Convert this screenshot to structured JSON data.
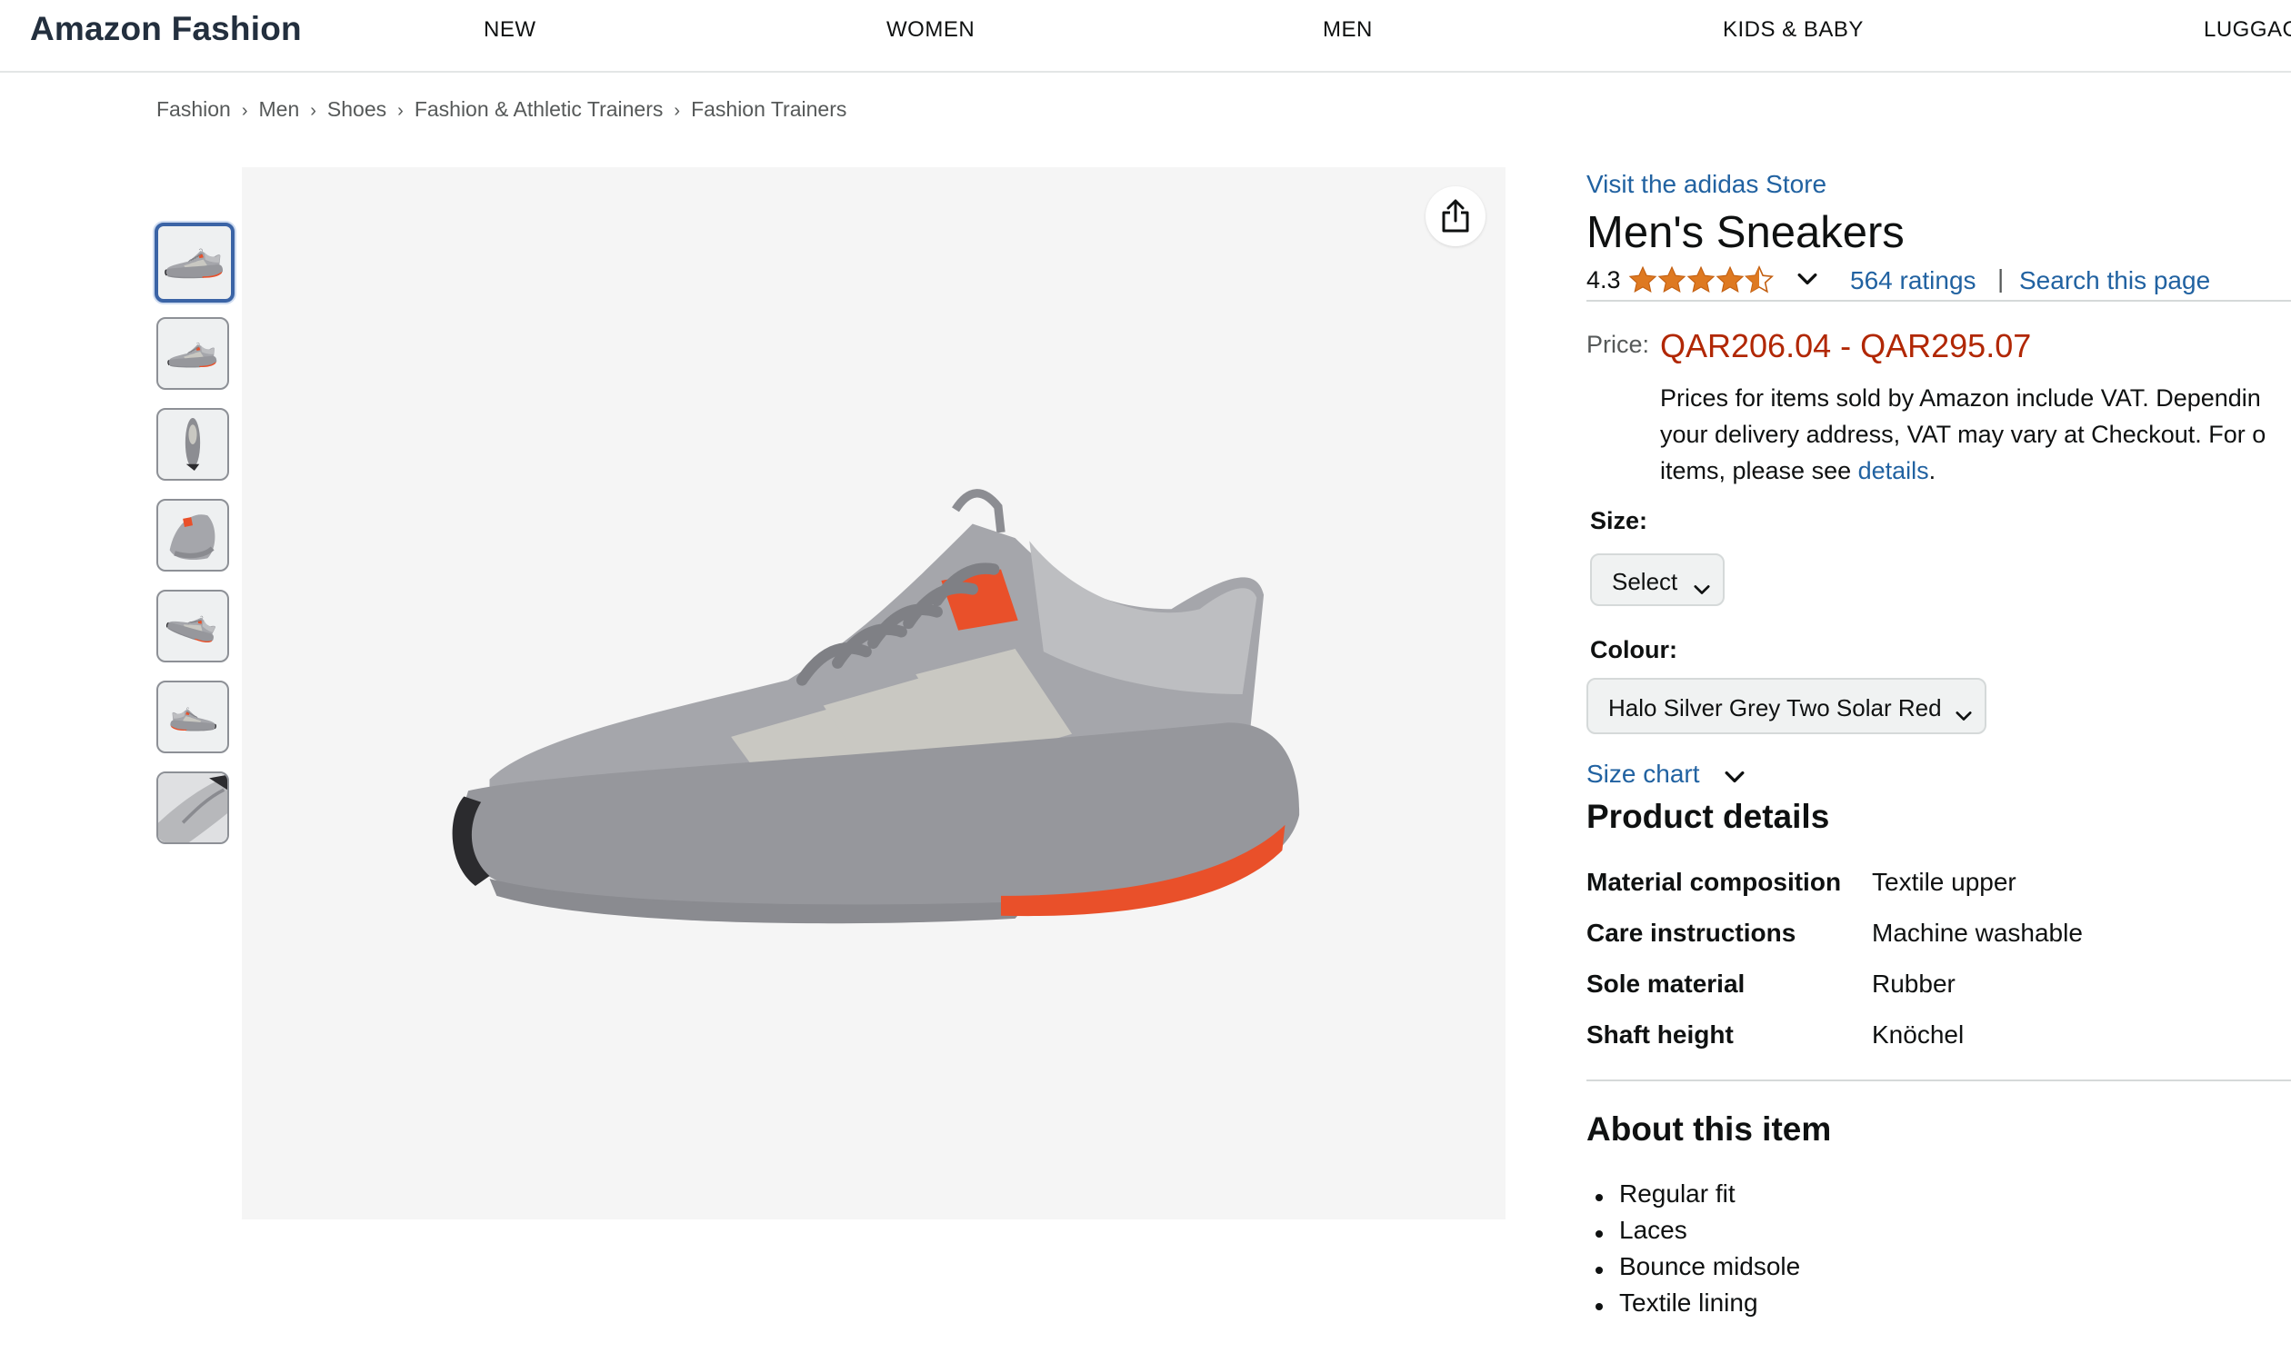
{
  "header": {
    "brand": "Amazon Fashion",
    "nav": [
      "NEW",
      "WOMEN",
      "MEN",
      "KIDS & BABY",
      "LUGGAG"
    ]
  },
  "breadcrumb": [
    "Fashion",
    "Men",
    "Shoes",
    "Fashion & Athletic Trainers",
    "Fashion Trainers"
  ],
  "breadcrumb_separator": "›",
  "gallery": {
    "thumbnail_count": 7,
    "selected_index": 0
  },
  "product": {
    "store_link": "Visit the adidas Store",
    "title": "Men's Sneakers",
    "rating": "4.3",
    "rating_stars": 4.5,
    "ratings_count": "564 ratings",
    "separator": "|",
    "search_link": "Search this page",
    "price_label": "Price:",
    "price_range": "QAR206.04 - QAR295.07",
    "vat_line1": "Prices for items sold by Amazon include VAT. Dependin",
    "vat_line2": "your delivery address, VAT may vary at Checkout. For o",
    "vat_line3_prefix": "items, please see ",
    "vat_link": "details",
    "vat_line3_suffix": "."
  },
  "size": {
    "label": "Size:",
    "selected": "Select"
  },
  "colour": {
    "label": "Colour:",
    "selected": "Halo Silver Grey Two Solar Red"
  },
  "size_chart": "Size chart",
  "product_details": {
    "title": "Product details",
    "rows": [
      {
        "key": "Material composition",
        "value": "Textile upper"
      },
      {
        "key": "Care instructions",
        "value": "Machine washable"
      },
      {
        "key": "Sole material",
        "value": "Rubber"
      },
      {
        "key": "Shaft height",
        "value": "Knöchel"
      }
    ]
  },
  "about": {
    "title": "About this item",
    "items": [
      "Regular fit",
      "Laces",
      "Bounce midsole",
      "Textile lining"
    ]
  },
  "colors": {
    "link": "#2162a1",
    "price": "#b12704",
    "star": "#de7921",
    "thumb_selected": "#3b64a6",
    "shoe_grey": "#a2a3a8",
    "shoe_accent": "#e9502a"
  },
  "icons": {
    "share": "share-icon",
    "star": "star-icon",
    "chevron": "chevron-down-icon"
  }
}
